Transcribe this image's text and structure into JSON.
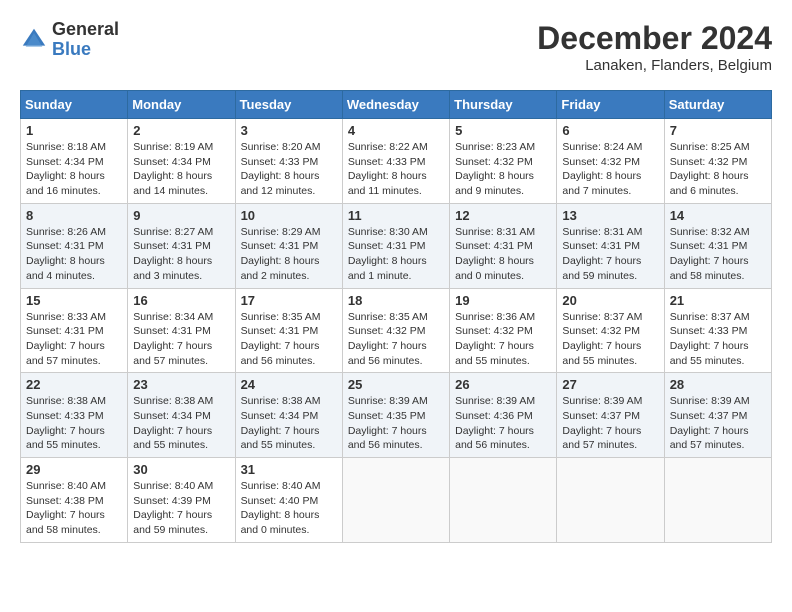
{
  "header": {
    "logo_line1": "General",
    "logo_line2": "Blue",
    "title": "December 2024",
    "subtitle": "Lanaken, Flanders, Belgium"
  },
  "weekdays": [
    "Sunday",
    "Monday",
    "Tuesday",
    "Wednesday",
    "Thursday",
    "Friday",
    "Saturday"
  ],
  "weeks": [
    [
      {
        "day": "1",
        "info": "Sunrise: 8:18 AM\nSunset: 4:34 PM\nDaylight: 8 hours and 16 minutes."
      },
      {
        "day": "2",
        "info": "Sunrise: 8:19 AM\nSunset: 4:34 PM\nDaylight: 8 hours and 14 minutes."
      },
      {
        "day": "3",
        "info": "Sunrise: 8:20 AM\nSunset: 4:33 PM\nDaylight: 8 hours and 12 minutes."
      },
      {
        "day": "4",
        "info": "Sunrise: 8:22 AM\nSunset: 4:33 PM\nDaylight: 8 hours and 11 minutes."
      },
      {
        "day": "5",
        "info": "Sunrise: 8:23 AM\nSunset: 4:32 PM\nDaylight: 8 hours and 9 minutes."
      },
      {
        "day": "6",
        "info": "Sunrise: 8:24 AM\nSunset: 4:32 PM\nDaylight: 8 hours and 7 minutes."
      },
      {
        "day": "7",
        "info": "Sunrise: 8:25 AM\nSunset: 4:32 PM\nDaylight: 8 hours and 6 minutes."
      }
    ],
    [
      {
        "day": "8",
        "info": "Sunrise: 8:26 AM\nSunset: 4:31 PM\nDaylight: 8 hours and 4 minutes."
      },
      {
        "day": "9",
        "info": "Sunrise: 8:27 AM\nSunset: 4:31 PM\nDaylight: 8 hours and 3 minutes."
      },
      {
        "day": "10",
        "info": "Sunrise: 8:29 AM\nSunset: 4:31 PM\nDaylight: 8 hours and 2 minutes."
      },
      {
        "day": "11",
        "info": "Sunrise: 8:30 AM\nSunset: 4:31 PM\nDaylight: 8 hours and 1 minute."
      },
      {
        "day": "12",
        "info": "Sunrise: 8:31 AM\nSunset: 4:31 PM\nDaylight: 8 hours and 0 minutes."
      },
      {
        "day": "13",
        "info": "Sunrise: 8:31 AM\nSunset: 4:31 PM\nDaylight: 7 hours and 59 minutes."
      },
      {
        "day": "14",
        "info": "Sunrise: 8:32 AM\nSunset: 4:31 PM\nDaylight: 7 hours and 58 minutes."
      }
    ],
    [
      {
        "day": "15",
        "info": "Sunrise: 8:33 AM\nSunset: 4:31 PM\nDaylight: 7 hours and 57 minutes."
      },
      {
        "day": "16",
        "info": "Sunrise: 8:34 AM\nSunset: 4:31 PM\nDaylight: 7 hours and 57 minutes."
      },
      {
        "day": "17",
        "info": "Sunrise: 8:35 AM\nSunset: 4:31 PM\nDaylight: 7 hours and 56 minutes."
      },
      {
        "day": "18",
        "info": "Sunrise: 8:35 AM\nSunset: 4:32 PM\nDaylight: 7 hours and 56 minutes."
      },
      {
        "day": "19",
        "info": "Sunrise: 8:36 AM\nSunset: 4:32 PM\nDaylight: 7 hours and 55 minutes."
      },
      {
        "day": "20",
        "info": "Sunrise: 8:37 AM\nSunset: 4:32 PM\nDaylight: 7 hours and 55 minutes."
      },
      {
        "day": "21",
        "info": "Sunrise: 8:37 AM\nSunset: 4:33 PM\nDaylight: 7 hours and 55 minutes."
      }
    ],
    [
      {
        "day": "22",
        "info": "Sunrise: 8:38 AM\nSunset: 4:33 PM\nDaylight: 7 hours and 55 minutes."
      },
      {
        "day": "23",
        "info": "Sunrise: 8:38 AM\nSunset: 4:34 PM\nDaylight: 7 hours and 55 minutes."
      },
      {
        "day": "24",
        "info": "Sunrise: 8:38 AM\nSunset: 4:34 PM\nDaylight: 7 hours and 55 minutes."
      },
      {
        "day": "25",
        "info": "Sunrise: 8:39 AM\nSunset: 4:35 PM\nDaylight: 7 hours and 56 minutes."
      },
      {
        "day": "26",
        "info": "Sunrise: 8:39 AM\nSunset: 4:36 PM\nDaylight: 7 hours and 56 minutes."
      },
      {
        "day": "27",
        "info": "Sunrise: 8:39 AM\nSunset: 4:37 PM\nDaylight: 7 hours and 57 minutes."
      },
      {
        "day": "28",
        "info": "Sunrise: 8:39 AM\nSunset: 4:37 PM\nDaylight: 7 hours and 57 minutes."
      }
    ],
    [
      {
        "day": "29",
        "info": "Sunrise: 8:40 AM\nSunset: 4:38 PM\nDaylight: 7 hours and 58 minutes."
      },
      {
        "day": "30",
        "info": "Sunrise: 8:40 AM\nSunset: 4:39 PM\nDaylight: 7 hours and 59 minutes."
      },
      {
        "day": "31",
        "info": "Sunrise: 8:40 AM\nSunset: 4:40 PM\nDaylight: 8 hours and 0 minutes."
      },
      null,
      null,
      null,
      null
    ]
  ]
}
